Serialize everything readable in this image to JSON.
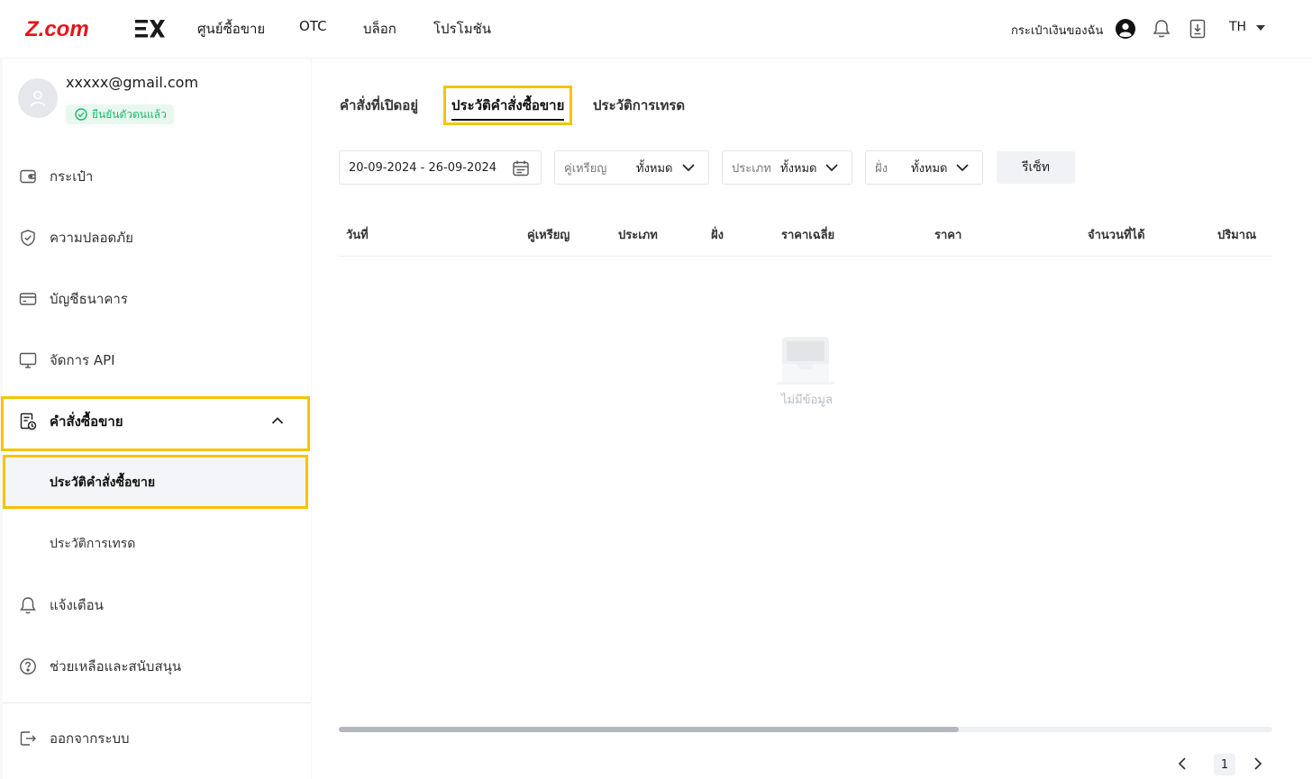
{
  "header": {
    "logo_text": "Z.comEX",
    "nav": [
      "ศูนย์ซื้อขาย",
      "OTC",
      "บล็อก",
      "โปรโมชัน"
    ],
    "wallet_link": "กระเป๋าเงินของฉัน",
    "language": "TH"
  },
  "sidebar": {
    "email": "xxxxx@gmail.com",
    "verified_label": "ยืนยันตัวตนแล้ว",
    "items": [
      {
        "label": "กระเป๋า",
        "icon": "wallet-icon"
      },
      {
        "label": "ความปลอดภัย",
        "icon": "shield-icon"
      },
      {
        "label": "บัญชีธนาคาร",
        "icon": "card-icon"
      },
      {
        "label": "จัดการ API",
        "icon": "monitor-icon"
      },
      {
        "label": "คำสั่งซื้อขาย",
        "icon": "order-icon",
        "expanded": true,
        "children": [
          "ประวัติคำสั่งซื้อขาย",
          "ประวัติการเทรด"
        ]
      },
      {
        "label": "แจ้งเตือน",
        "icon": "bell-icon"
      },
      {
        "label": "ช่วยเหลือและสนับสนุน",
        "icon": "help-icon"
      }
    ],
    "logout": "ออกจากระบบ"
  },
  "main": {
    "tabs": [
      "คำสั่งที่เปิดอยู่",
      "ประวัติคำสั่งซื้อขาย",
      "ประวัติการเทรด"
    ],
    "active_tab": "ประวัติคำสั่งซื้อขาย",
    "filters": {
      "date_range": "20-09-2024 - 26-09-2024",
      "pair_label": "คู่เหรียญ",
      "pair_value": "ทั้งหมด",
      "type_label": "ประเภท",
      "type_value": "ทั้งหมด",
      "side_label": "ฝั่ง",
      "side_value": "ทั้งหมด",
      "reset_label": "รีเซ็ท"
    },
    "columns": [
      "วันที่",
      "คู่เหรียญ",
      "ประเภท",
      "ฝั่ง",
      "ราคาเฉลี่ย",
      "ราคา",
      "จำนวนที่ได้",
      "ปริมาณ"
    ],
    "empty_text": "ไม่มีข้อมูล",
    "pagination": {
      "current_page": "1"
    }
  },
  "colors": {
    "highlight": "#f5c400",
    "brand_red": "#e8131b",
    "verified_green": "#1fb86b"
  }
}
